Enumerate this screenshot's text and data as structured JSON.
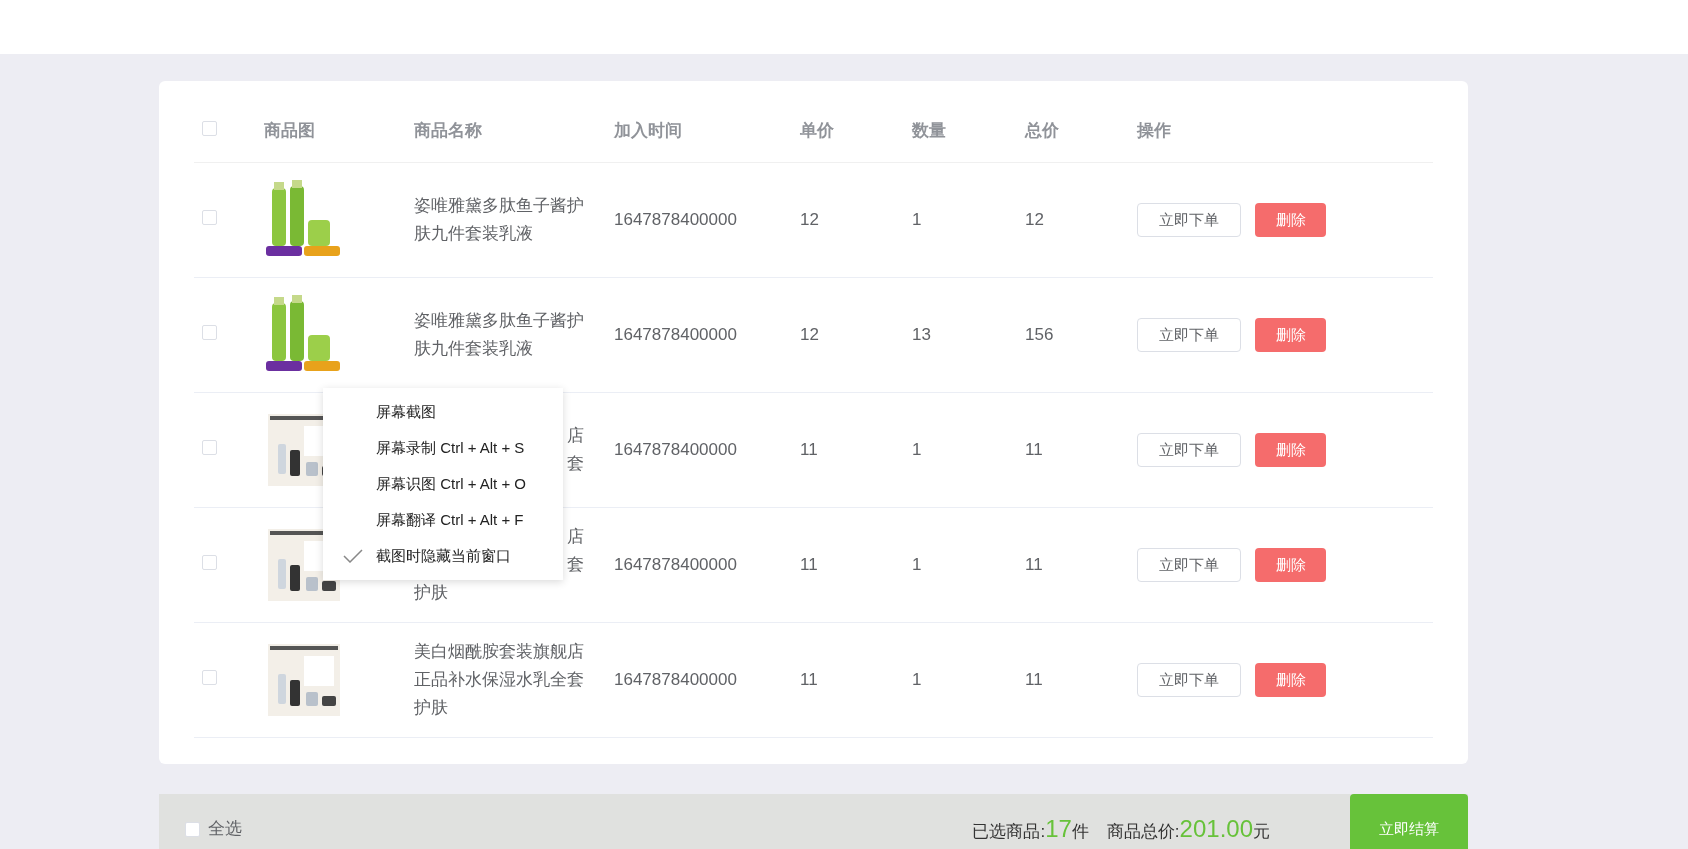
{
  "table": {
    "header_checked": false,
    "columns": [
      "商品图",
      "商品名称",
      "加入时间",
      "单价",
      "数量",
      "总价",
      "操作"
    ],
    "rows": [
      {
        "checked": false,
        "name_lines": [
          "姿唯雅黛多肽鱼子酱护",
          "肤九件套装乳液"
        ],
        "time": "1647878400000",
        "price": "12",
        "qty": "1",
        "total": "12",
        "order": "立即下单",
        "delete": "删除"
      },
      {
        "checked": false,
        "name_lines": [
          "姿唯雅黛多肽鱼子酱护",
          "肤九件套装乳液"
        ],
        "time": "1647878400000",
        "price": "12",
        "qty": "13",
        "total": "156",
        "order": "立即下单",
        "delete": "删除"
      },
      {
        "checked": false,
        "name_line_ends": [
          "店",
          "套"
        ],
        "time": "1647878400000",
        "price": "11",
        "qty": "1",
        "total": "11",
        "order": "立即下单",
        "delete": "删除"
      },
      {
        "checked": false,
        "name_line_ends": [
          "店",
          "套"
        ],
        "name_lines": [
          "护肤"
        ],
        "time": "1647878400000",
        "price": "11",
        "qty": "1",
        "total": "11",
        "order": "立即下单",
        "delete": "删除"
      },
      {
        "checked": false,
        "name_lines": [
          "美白烟酰胺套装旗舰店",
          "正品补水保湿水乳全套",
          "护肤"
        ],
        "time": "1647878400000",
        "price": "11",
        "qty": "1",
        "total": "11",
        "order": "立即下单",
        "delete": "删除"
      }
    ]
  },
  "context_menu": {
    "items": [
      {
        "label": "屏幕截图",
        "checked": false
      },
      {
        "label": "屏幕录制 Ctrl + Alt + S",
        "checked": false
      },
      {
        "label": "屏幕识图 Ctrl + Alt + O",
        "checked": false
      },
      {
        "label": "屏幕翻译 Ctrl + Alt + F",
        "checked": false
      },
      {
        "label": "截图时隐藏当前窗口",
        "checked": true
      }
    ]
  },
  "footer": {
    "select_all_checked": false,
    "select_all": "全选",
    "selected_label": "已选商品:",
    "selected_count": "17",
    "selected_unit": "件",
    "total_label": "商品总价:",
    "total_value": "201.00",
    "total_unit": "元",
    "checkout": "立即结算"
  }
}
